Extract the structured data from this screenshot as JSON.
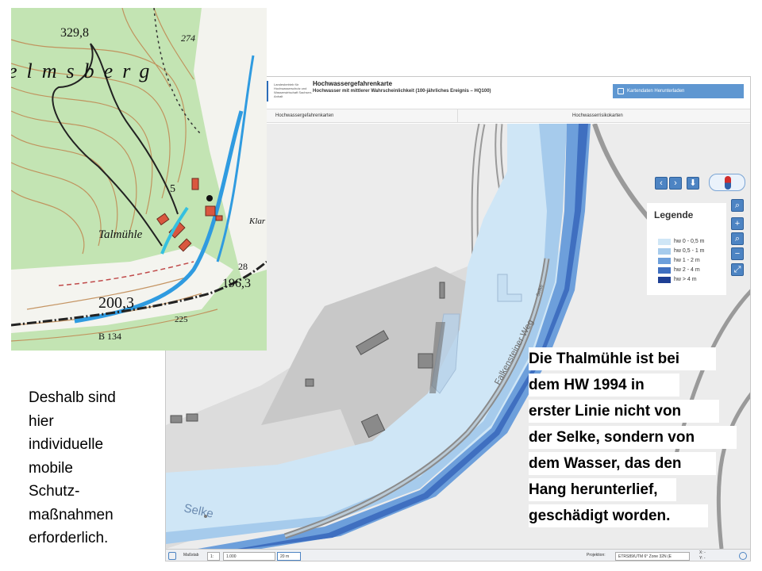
{
  "viewer": {
    "agency_logo_text": "Landesbetrieb für Hochwasserschutz und Wasserwirtschaft Sachsen-Anhalt",
    "title": "Hochwassergefahrenkarte",
    "subtitle": "Hochwasser mit mittlerer Wahrscheinlichkeit (100-jährliches Ereignis – HQ100)",
    "download_label": "Kartendaten Herunterladen",
    "tabs": [
      {
        "label": "Hochwassergefahrenkarten"
      },
      {
        "label": "Hochwasserrisikokarten"
      }
    ],
    "map": {
      "road_label": "Falkensteiner Weg",
      "road_label_2": "Selke",
      "river_label": "Selke"
    },
    "controls": {
      "prev_icon": "chevron-left-icon",
      "next_icon": "chevron-right-icon",
      "person_icon": "person-icon",
      "compass_icon": "compass-icon",
      "zoom_in": "+",
      "zoom_out": "−"
    },
    "legend": {
      "title": "Legende",
      "items": [
        {
          "label": "hw 0 - 0,5 m",
          "color": "#cfe6f6"
        },
        {
          "label": "hw 0,5 - 1 m",
          "color": "#a6cbec"
        },
        {
          "label": "hw 1 - 2 m",
          "color": "#6d9fdb"
        },
        {
          "label": "hw 2 - 4 m",
          "color": "#3f6fc0"
        },
        {
          "label": "hw > 4 m",
          "color": "#1e3f94"
        }
      ]
    },
    "statusbar": {
      "scale_label": "Maßstab",
      "scale_prefix": "1:",
      "scale_value": "1.000",
      "scalebar_label": "20 m",
      "projection_label": "Projektion:",
      "projection_value": "ETRS89/UTM 6° Zone 32N (E",
      "coord_x": "X: -",
      "coord_y": "Y: -"
    }
  },
  "topo": {
    "labels": {
      "height_1": "329,8",
      "height_2": "274",
      "hill_name": "elmsberg",
      "contour_5": "5",
      "place": "Talmühle",
      "height_3": "200,3",
      "height_4": "196,3",
      "number_28": "28",
      "road": "B 134",
      "edge_text": "Klar",
      "height_5": "225"
    }
  },
  "texts": {
    "left_lines": [
      "Deshalb sind",
      "hier",
      "individuelle",
      "mobile",
      "Schutz-",
      "maßnahmen",
      "erforderlich."
    ],
    "callout_lines": [
      "Die Thalmühle ist bei",
      "dem HW 1994 in",
      "erster Linie nicht von",
      "der Selke, sondern von",
      "dem Wasser, das den",
      "Hang herunterlief,",
      "geschädigt worden."
    ]
  },
  "colors": {
    "flood_light": "#cfe6f6",
    "flood_mid": "#a6cbec",
    "flood_deep": "#6d9fdb",
    "river": "#3f6fc0",
    "accent": "#4d84c3"
  }
}
